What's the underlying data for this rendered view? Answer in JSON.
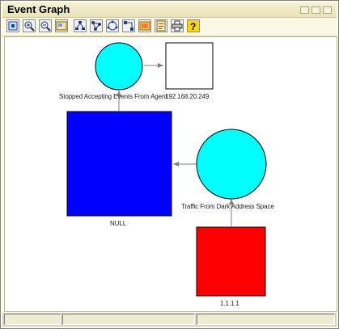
{
  "window": {
    "title": "Event Graph"
  },
  "toolbar": {
    "buttons": [
      {
        "name": "fit-to-window-icon"
      },
      {
        "name": "zoom-in-icon"
      },
      {
        "name": "zoom-out-icon"
      },
      {
        "name": "overview-icon"
      },
      {
        "name": "hierarchic-layout-icon"
      },
      {
        "name": "organic-layout-icon"
      },
      {
        "name": "circular-layout-icon"
      },
      {
        "name": "orthogonal-layout-icon"
      },
      {
        "name": "export-image-icon"
      },
      {
        "name": "properties-icon"
      },
      {
        "name": "print-icon"
      },
      {
        "name": "help-icon"
      }
    ]
  },
  "graph": {
    "nodes": [
      {
        "id": "stopped",
        "shape": "circle",
        "color": "#00ffff",
        "label": "Stopped Accepting Events From Agent"
      },
      {
        "id": "ip",
        "shape": "square",
        "color": "#ffffff",
        "label": "192.168.20.249"
      },
      {
        "id": "null",
        "shape": "square",
        "color": "#0000ff",
        "label": "NULL"
      },
      {
        "id": "traffic",
        "shape": "circle",
        "color": "#00ffff",
        "label": "Traffic From Dark Address Space"
      },
      {
        "id": "addr",
        "shape": "square",
        "color": "#ff0000",
        "label": "1.1.1.1"
      }
    ],
    "edges": [
      {
        "from": "stopped",
        "to": "ip"
      },
      {
        "from": "null",
        "to": "stopped"
      },
      {
        "from": "traffic",
        "to": "null"
      },
      {
        "from": "addr",
        "to": "traffic"
      }
    ],
    "edge_color": "#808080"
  },
  "status": {
    "cells": [
      "",
      "",
      ""
    ]
  }
}
